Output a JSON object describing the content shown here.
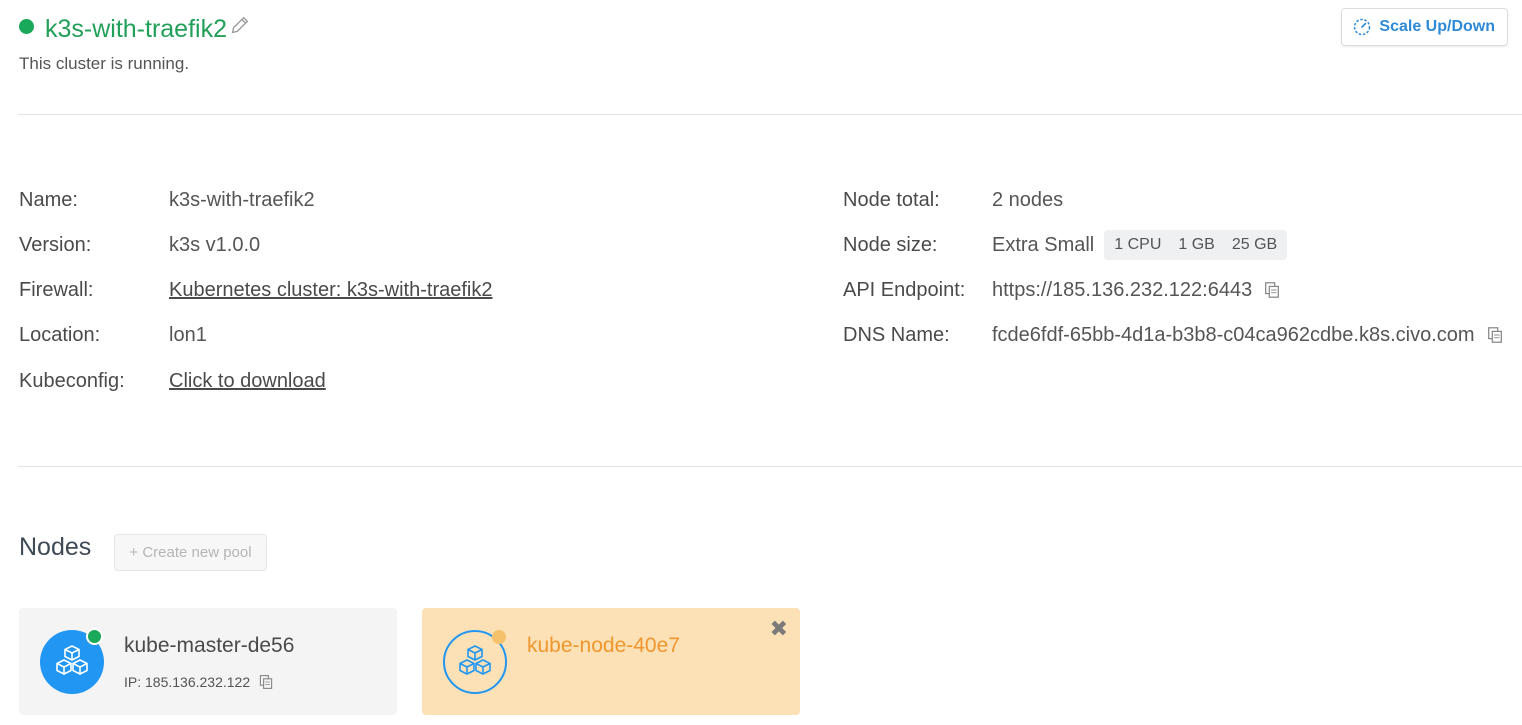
{
  "cluster": {
    "name": "k3s-with-traefik2",
    "status_text": "This cluster is running.",
    "status_color": "#1aa85a"
  },
  "toolbar": {
    "scale_label": "Scale Up/Down"
  },
  "details": {
    "left": [
      {
        "label": "Name:",
        "value": "k3s-with-traefik2"
      },
      {
        "label": "Version:",
        "value": "k3s v1.0.0"
      },
      {
        "label": "Firewall:",
        "value": "Kubernetes cluster: k3s-with-traefik2"
      },
      {
        "label": "Location:",
        "value": "lon1"
      },
      {
        "label": "Kubeconfig:",
        "value": "Click to download"
      }
    ],
    "right": [
      {
        "label": "Node total:",
        "value": "2 nodes"
      },
      {
        "label": "Node size:",
        "value": "Extra Small",
        "specs": [
          "1 CPU",
          "1 GB",
          "25 GB"
        ]
      },
      {
        "label": "API Endpoint:",
        "value": "https://185.136.232.122:6443"
      },
      {
        "label": "DNS Name:",
        "value": "fcde6fdf-65bb-4d1a-b3b8-c04ca962cdbe.k8s.civo.com"
      }
    ]
  },
  "nodes": {
    "title": "Nodes",
    "create_pool_label": "+ Create new pool",
    "items": [
      {
        "name": "kube-master-de56",
        "ip": "IP: 185.136.232.122",
        "status": "running"
      },
      {
        "name": "kube-node-40e7",
        "status": "pending"
      }
    ]
  },
  "colors": {
    "accent_blue": "#2196f3",
    "running_green": "#1aa85a",
    "pending_orange": "#f0962e",
    "pending_bg": "#fbe1b5"
  }
}
